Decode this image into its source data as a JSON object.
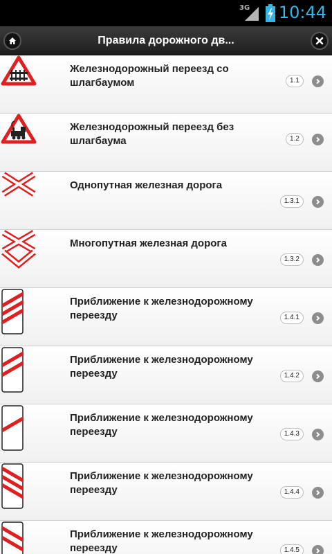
{
  "status_bar": {
    "network": "3G",
    "time": "10:44"
  },
  "header": {
    "title": "Правила дорожного дв...",
    "home_icon": "home-icon",
    "close_icon": "close-icon"
  },
  "items": [
    {
      "label": "Железнодорожный переезд со шлагбаумом",
      "code": "1.1",
      "sign": "railway-crossing-barrier-sign"
    },
    {
      "label": "Железнодорожный переезд без шлагбаума",
      "code": "1.2",
      "sign": "railway-crossing-no-barrier-sign"
    },
    {
      "label": "Однопутная железная дорога",
      "code": "1.3.1",
      "sign": "single-track-cross-sign"
    },
    {
      "label": "Многопутная железная дорога",
      "code": "1.3.2",
      "sign": "multi-track-cross-sign"
    },
    {
      "label": "Приближение к железнодорожному переезду",
      "code": "1.4.1",
      "sign": "approach-three-stripes-right-sign"
    },
    {
      "label": "Приближение к железнодорожному переезду",
      "code": "1.4.2",
      "sign": "approach-two-stripes-right-sign"
    },
    {
      "label": "Приближение к железнодорожному переезду",
      "code": "1.4.3",
      "sign": "approach-one-stripe-right-sign"
    },
    {
      "label": "Приближение к железнодорожному переезду",
      "code": "1.4.4",
      "sign": "approach-three-stripes-left-sign"
    },
    {
      "label": "Приближение к железнодорожному переезду",
      "code": "1.4.5",
      "sign": "approach-two-stripes-left-sign"
    }
  ],
  "colors": {
    "sign_red": "#e02020",
    "clock_blue": "#33b5e5",
    "chevron_gray": "#8d8d8d"
  }
}
